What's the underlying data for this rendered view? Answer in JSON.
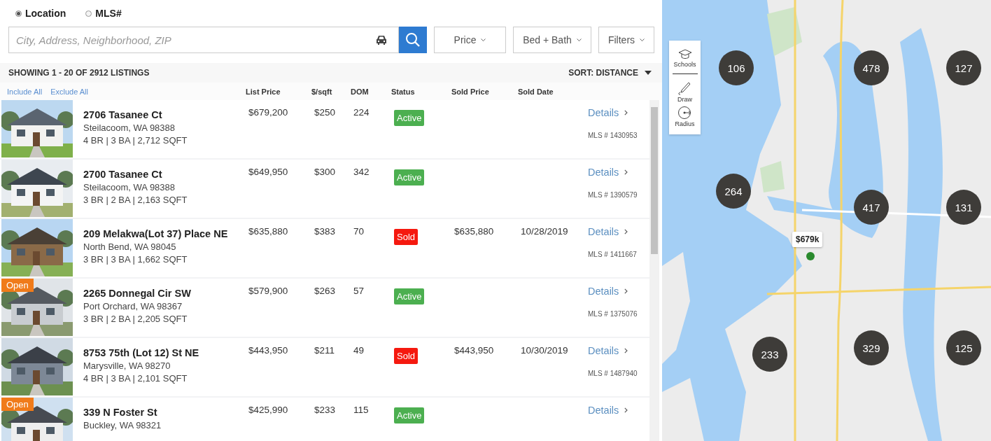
{
  "search_mode": [
    {
      "label": "Location",
      "selected": true
    },
    {
      "label": "MLS#",
      "selected": false
    }
  ],
  "search": {
    "placeholder": "City, Address, Neighborhood, ZIP"
  },
  "filters": [
    "Price",
    "Bed + Bath",
    "Filters"
  ],
  "results": {
    "summary": "SHOWING 1 - 20 OF 2912 LISTINGS",
    "sort": "SORT: DISTANCE"
  },
  "table": {
    "include_all": "Include All",
    "exclude_all": "Exclude All",
    "columns": [
      "List Price",
      "$/sqft",
      "DOM",
      "Status",
      "Sold Price",
      "Sold Date"
    ],
    "rows": [
      {
        "address": "2706 Tasanee Ct",
        "city": "Steilacoom, WA 98388",
        "specs": "4 BR | 3 BA | 2,712 SQFT",
        "list_price": "$679,200",
        "price_sqft": "$250",
        "dom": "224",
        "status": {
          "kind": "active",
          "label": "Active"
        },
        "details": "Details",
        "mls": "MLS # 1430953"
      },
      {
        "address": "2700 Tasanee Ct",
        "city": "Steilacoom, WA 98388",
        "specs": "3 BR | 2 BA | 2,163 SQFT",
        "list_price": "$649,950",
        "price_sqft": "$300",
        "dom": "342",
        "status": {
          "kind": "active",
          "label": "Active"
        },
        "details": "Details",
        "mls": "MLS # 1390579"
      },
      {
        "address": "209 Melakwa(Lot 37) Place NE",
        "city": "North Bend, WA 98045",
        "specs": "3 BR | 3 BA | 1,662 SQFT",
        "list_price": "$635,880",
        "price_sqft": "$383",
        "dom": "70",
        "status": {
          "kind": "sold",
          "label": "Sold"
        },
        "sold_price": "$635,880",
        "sold_date": "10/28/2019",
        "details": "Details",
        "mls": "MLS # 1411667"
      },
      {
        "badge": "Open",
        "address": "2265 Donnegal Cir SW",
        "city": "Port Orchard, WA 98367",
        "specs": "3 BR | 2 BA | 2,205 SQFT",
        "list_price": "$579,900",
        "price_sqft": "$263",
        "dom": "57",
        "status": {
          "kind": "active",
          "label": "Active"
        },
        "details": "Details",
        "mls": "MLS # 1375076"
      },
      {
        "address": "8753 75th (Lot 12) St NE",
        "city": "Marysville, WA 98270",
        "specs": "4 BR | 3 BA | 2,101 SQFT",
        "list_price": "$443,950",
        "price_sqft": "$211",
        "dom": "49",
        "status": {
          "kind": "sold",
          "label": "Sold"
        },
        "sold_price": "$443,950",
        "sold_date": "10/30/2019",
        "details": "Details",
        "mls": "MLS # 1487940"
      },
      {
        "badge": "Open",
        "address": "339 N Foster St",
        "city": "Buckley, WA 98321",
        "list_price": "$425,990",
        "price_sqft": "$233",
        "dom": "115",
        "status": {
          "kind": "active",
          "label": "Active"
        },
        "details": "Details"
      }
    ]
  },
  "map": {
    "tools": [
      {
        "kind": "schools",
        "label": "Schools"
      },
      {
        "kind": "draw",
        "label": "Draw"
      },
      {
        "kind": "radius",
        "label": "Radius"
      }
    ],
    "clusters": [
      "106",
      "478",
      "127",
      "264",
      "417",
      "131",
      "233",
      "329",
      "125"
    ],
    "price_tag": "$679k"
  }
}
